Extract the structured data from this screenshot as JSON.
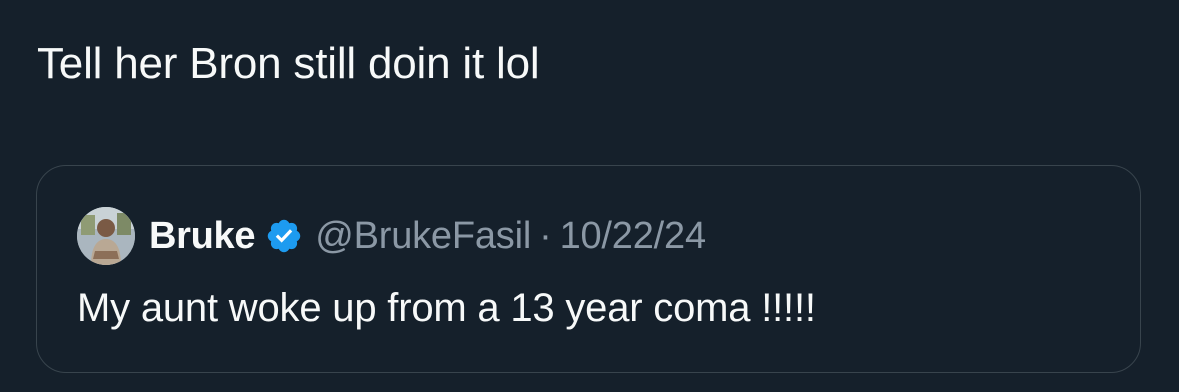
{
  "tweet": {
    "text": "Tell her Bron still doin it lol"
  },
  "quoted_tweet": {
    "author_name": "Bruke",
    "verified": true,
    "handle": "@BrukeFasil",
    "separator": "·",
    "date": "10/22/24",
    "text": "My aunt woke up from a 13 year coma !!!!!"
  },
  "colors": {
    "background": "#15202b",
    "primary_text": "#f7f9f9",
    "secondary_text": "#8b98a5",
    "border": "#38444d",
    "verified_badge": "#1d9bf0"
  },
  "icons": {
    "verified": "verified-badge-icon",
    "avatar": "user-avatar"
  }
}
